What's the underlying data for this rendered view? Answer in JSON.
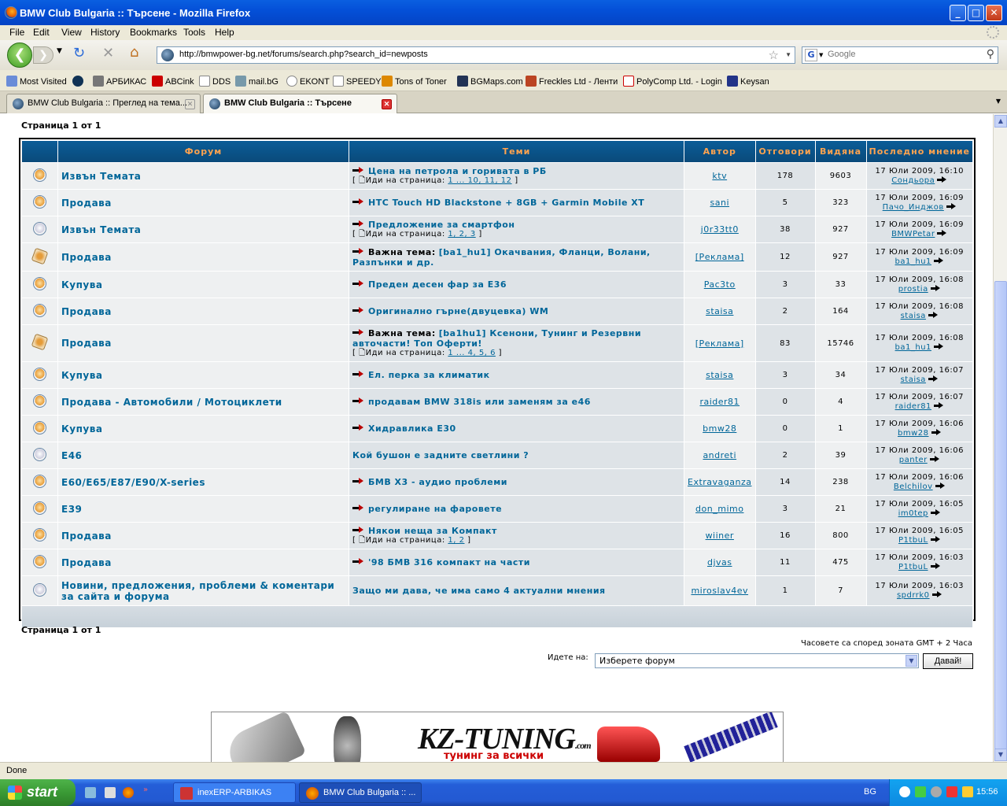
{
  "window": {
    "title": "BMW Club Bulgaria :: Търсене - Mozilla Firefox"
  },
  "menu": [
    "File",
    "Edit",
    "View",
    "History",
    "Bookmarks",
    "Tools",
    "Help"
  ],
  "nav": {
    "url": "http://bmwpower-bg.net/forums/search.php?search_id=newposts",
    "search_placeholder": "Google"
  },
  "bookmarks": [
    "Most Visited",
    "АРБИКАС",
    "ABCink",
    "DDS",
    "mail.bG",
    "EKONT",
    "SPEEDY",
    "Tons of Toner",
    "BGMaps.com",
    "Freckles Ltd - Ленти",
    "PolyComp Ltd. - Login",
    "Keysan"
  ],
  "tabs": [
    {
      "label": "BMW Club Bulgaria :: Преглед на тема...",
      "active": false
    },
    {
      "label": "BMW Club Bulgaria :: Търсене",
      "active": true
    }
  ],
  "page": {
    "page_info": "Страница 1 от 1",
    "headers": [
      "Форум",
      "Теми",
      "Автор",
      "Отговори",
      "Видяна",
      "Последно мнение"
    ],
    "sticky_label": "Важна тема:",
    "goto_label": "Иди на страница:",
    "rows": [
      {
        "icon": "new",
        "forum": "Извън Темата",
        "topic": "Цена на петрола и горивата в РБ",
        "sticky": false,
        "pages": "1 ... 10, 11, 12",
        "author": "ktv",
        "replies": "178",
        "views": "9603",
        "last_date": "17 Юли 2009, 16:10",
        "last_user": "Сондьора"
      },
      {
        "icon": "new",
        "forum": "Продава",
        "topic": "HTC Touch HD Blackstone + 8GB + Garmin Mobile XT",
        "sticky": false,
        "pages": "",
        "author": "sani",
        "replies": "5",
        "views": "323",
        "last_date": "17 Юли 2009, 16:09",
        "last_user": "Пачо_Инджов"
      },
      {
        "icon": "old",
        "forum": "Извън Темата",
        "topic": "Предложение за смартфон",
        "sticky": false,
        "pages": "1, 2, 3",
        "author": "j0r33tt0",
        "replies": "38",
        "views": "927",
        "last_date": "17 Юли 2009, 16:09",
        "last_user": "BMWPetar"
      },
      {
        "icon": "sticky",
        "forum": "Продава",
        "topic": "[ba1_hu1] Окачвания, Фланци, Волани, Разпънки и др.",
        "sticky": true,
        "pages": "",
        "author": "[Реклама]",
        "replies": "12",
        "views": "927",
        "last_date": "17 Юли 2009, 16:09",
        "last_user": "ba1_hu1"
      },
      {
        "icon": "new",
        "forum": "Купува",
        "topic": "Преден десен фар за Е36",
        "sticky": false,
        "pages": "",
        "author": "Pac3to",
        "replies": "3",
        "views": "33",
        "last_date": "17 Юли 2009, 16:08",
        "last_user": "prostia"
      },
      {
        "icon": "new",
        "forum": "Продава",
        "topic": "Оригинално гърне(двуцевка) WM",
        "sticky": false,
        "pages": "",
        "author": "staisa",
        "replies": "2",
        "views": "164",
        "last_date": "17 Юли 2009, 16:08",
        "last_user": "staisa"
      },
      {
        "icon": "sticky",
        "forum": "Продава",
        "topic": "[ba1hu1] Ксенони, Тунинг и Резервни авточасти! Топ Оферти!",
        "sticky": true,
        "pages": "1 ... 4, 5, 6",
        "author": "[Реклама]",
        "replies": "83",
        "views": "15746",
        "last_date": "17 Юли 2009, 16:08",
        "last_user": "ba1_hu1"
      },
      {
        "icon": "new",
        "forum": "Купува",
        "topic": "Ел. перка за климатик",
        "sticky": false,
        "pages": "",
        "author": "staisa",
        "replies": "3",
        "views": "34",
        "last_date": "17 Юли 2009, 16:07",
        "last_user": "staisa"
      },
      {
        "icon": "new",
        "forum": "Продава - Автомобили / Мотоциклети",
        "topic": "продавам BMW 318is или заменям за e46",
        "sticky": false,
        "pages": "",
        "author": "raider81",
        "replies": "0",
        "views": "4",
        "last_date": "17 Юли 2009, 16:07",
        "last_user": "raider81"
      },
      {
        "icon": "new",
        "forum": "Купува",
        "topic": "Хидравлика Е30",
        "sticky": false,
        "pages": "",
        "author": "bmw28",
        "replies": "0",
        "views": "1",
        "last_date": "17 Юли 2009, 16:06",
        "last_user": "bmw28"
      },
      {
        "icon": "old",
        "forum": "E46",
        "topic": "Кой бушон е задните светлини ?",
        "sticky": false,
        "noarrow": true,
        "pages": "",
        "author": "andreti",
        "replies": "2",
        "views": "39",
        "last_date": "17 Юли 2009, 16:06",
        "last_user": "panter"
      },
      {
        "icon": "new",
        "forum": "E60/E65/E87/E90/X-series",
        "topic": "БМВ Х3 - аудио проблеми",
        "sticky": false,
        "pages": "",
        "author": "Extravaganza",
        "replies": "14",
        "views": "238",
        "last_date": "17 Юли 2009, 16:06",
        "last_user": "Belchilov"
      },
      {
        "icon": "new",
        "forum": "E39",
        "topic": "регулиране на фаровете",
        "sticky": false,
        "pages": "",
        "author": "don_mimo",
        "replies": "3",
        "views": "21",
        "last_date": "17 Юли 2009, 16:05",
        "last_user": "im0tep"
      },
      {
        "icon": "new",
        "forum": "Продава",
        "topic": "Някои неща за Компакт",
        "sticky": false,
        "pages": "1, 2",
        "author": "wiiner",
        "replies": "16",
        "views": "800",
        "last_date": "17 Юли 2009, 16:05",
        "last_user": "P1tbuL"
      },
      {
        "icon": "new",
        "forum": "Продава",
        "topic": "'98 БМВ 316 компакт на части",
        "sticky": false,
        "pages": "",
        "author": "djvas",
        "replies": "11",
        "views": "475",
        "last_date": "17 Юли 2009, 16:03",
        "last_user": "P1tbuL"
      },
      {
        "icon": "old",
        "forum": "Новини, предложения, проблеми & коментари за сайта и форума",
        "topic": "Защо ми дава, че има само 4 актуални мнения",
        "sticky": false,
        "noarrow": true,
        "pages": "",
        "author": "miroslav4ev",
        "replies": "1",
        "views": "7",
        "last_date": "17 Юли 2009, 16:03",
        "last_user": "spdrrk0"
      }
    ],
    "timezone": "Часовете са според зоната GMT + 2 Часа",
    "jump_label": "Идете на:",
    "jump_value": "Изберете форум",
    "jump_button": "Давай!",
    "banner": {
      "logo": "KZ-TUNING",
      "logo_suffix": ".com",
      "tagline": "тунинг за всички"
    }
  },
  "status": "Done",
  "taskbar": {
    "start": "start",
    "tasks": [
      "inexERP-ARBIKAS",
      "BMW Club Bulgaria :: ..."
    ],
    "lang": "BG",
    "clock": "15:56"
  }
}
